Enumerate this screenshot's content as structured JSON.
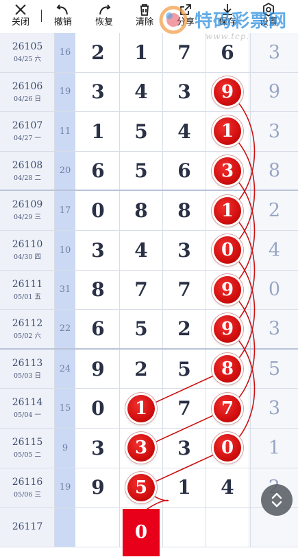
{
  "toolbar": {
    "items": [
      {
        "name": "close",
        "label": "关闭",
        "icon": "close-icon"
      },
      {
        "name": "undo",
        "label": "撤销",
        "icon": "undo-icon"
      },
      {
        "name": "redo",
        "label": "恢复",
        "icon": "redo-icon"
      },
      {
        "name": "clear",
        "label": "清除",
        "icon": "trash-icon"
      },
      {
        "name": "share",
        "label": "分享",
        "icon": "share-icon"
      },
      {
        "name": "save",
        "label": "保存",
        "icon": "download-icon"
      },
      {
        "name": "settings",
        "label": "设置",
        "icon": "gear-icon"
      }
    ]
  },
  "watermark": {
    "brand": "特码彩票网",
    "url": "www.tcp.net"
  },
  "colors": {
    "ball": "#d20e0e",
    "line": "#cc1111",
    "sum_col": "#cbd9f4",
    "period_col": "#eef1f8"
  },
  "rows": [
    {
      "period": "26105",
      "date": "04/25 六",
      "sum": "16",
      "d": [
        "2",
        "1",
        "7",
        "6"
      ],
      "tail": "3",
      "mark": null
    },
    {
      "period": "26106",
      "date": "04/26 日",
      "sum": "19",
      "d": [
        "3",
        "4",
        "3",
        "9"
      ],
      "tail": "9",
      "mark": 3
    },
    {
      "period": "26107",
      "date": "04/27 一",
      "sum": "11",
      "d": [
        "1",
        "5",
        "4",
        "1"
      ],
      "tail": "3",
      "mark": 3
    },
    {
      "period": "26108",
      "date": "04/28 二",
      "sum": "20",
      "d": [
        "6",
        "5",
        "6",
        "3"
      ],
      "tail": "8",
      "mark": 3
    },
    {
      "period": "26109",
      "date": "04/29 三",
      "sum": "17",
      "d": [
        "0",
        "8",
        "8",
        "1"
      ],
      "tail": "2",
      "mark": 3
    },
    {
      "period": "26110",
      "date": "04/30 四",
      "sum": "10",
      "d": [
        "3",
        "4",
        "3",
        "0"
      ],
      "tail": "4",
      "mark": 3
    },
    {
      "period": "26111",
      "date": "05/01 五",
      "sum": "31",
      "d": [
        "8",
        "7",
        "7",
        "9"
      ],
      "tail": "0",
      "mark": 3
    },
    {
      "period": "26112",
      "date": "05/02 六",
      "sum": "22",
      "d": [
        "6",
        "5",
        "2",
        "9"
      ],
      "tail": "3",
      "mark": 3
    },
    {
      "period": "26113",
      "date": "05/03 日",
      "sum": "24",
      "d": [
        "9",
        "2",
        "5",
        "8"
      ],
      "tail": "5",
      "mark": 3
    },
    {
      "period": "26114",
      "date": "05/04 一",
      "sum": "15",
      "d": [
        "0",
        "1",
        "7",
        "7"
      ],
      "tail": "3",
      "mark": [
        1,
        3
      ]
    },
    {
      "period": "26115",
      "date": "05/05 二",
      "sum": "9",
      "d": [
        "3",
        "3",
        "3",
        "0"
      ],
      "tail": "1",
      "mark": [
        1,
        3
      ]
    },
    {
      "period": "26116",
      "date": "05/06 三",
      "sum": "19",
      "d": [
        "9",
        "5",
        "1",
        "4"
      ],
      "tail": "2",
      "mark": 1
    },
    {
      "period": "26117",
      "date": "",
      "sum": "",
      "d": [
        "",
        "0",
        "",
        ""
      ],
      "tail": "",
      "mark": "box1"
    }
  ],
  "fab": {
    "icon": "scroll-updown-icon"
  }
}
